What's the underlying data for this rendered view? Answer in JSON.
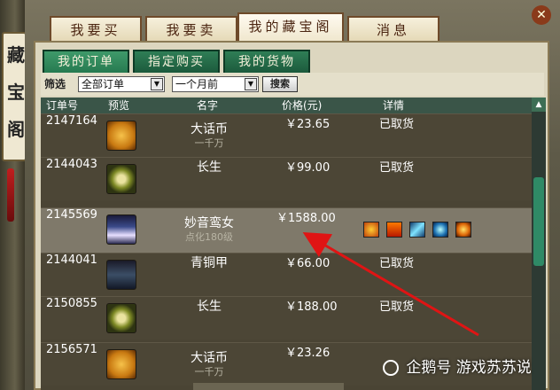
{
  "left_rail": {
    "chars": [
      "藏",
      "宝",
      "阁"
    ]
  },
  "main_tabs": [
    {
      "label": "我要买",
      "active": false
    },
    {
      "label": "我要卖",
      "active": false
    },
    {
      "label": "我的藏宝阁",
      "active": true
    },
    {
      "label": "消息",
      "active": false
    }
  ],
  "sub_tabs": [
    {
      "label": "我的订单",
      "active": true
    },
    {
      "label": "指定购买",
      "active": false
    },
    {
      "label": "我的货物",
      "active": false
    }
  ],
  "filter": {
    "label": "筛选",
    "order_type": "全部订单",
    "period": "一个月前",
    "search_label": "搜索"
  },
  "table": {
    "headers": [
      "订单号",
      "预览",
      "名字",
      "价格(元)",
      "详情"
    ],
    "rows": [
      {
        "order_id": "2147164",
        "thumb": "coin-icon",
        "name": "大话币",
        "sub": "一千万",
        "price": "￥23.65",
        "detail": "已取货"
      },
      {
        "order_id": "2144043",
        "thumb": "medal-icon",
        "name": "长生",
        "sub": "",
        "price": "￥99.00",
        "detail": "已取货"
      },
      {
        "order_id": "2145569",
        "thumb": "girl-portrait",
        "name": "妙音鸾女",
        "sub": "点化180级",
        "price": "￥1588.00",
        "detail": "",
        "highlighted": true
      },
      {
        "order_id": "2144041",
        "thumb": "armor-icon",
        "name": "青铜甲",
        "sub": "",
        "price": "￥66.00",
        "detail": "已取货"
      },
      {
        "order_id": "2150855",
        "thumb": "medal-icon",
        "name": "长生",
        "sub": "",
        "price": "￥188.00",
        "detail": "已取货"
      },
      {
        "order_id": "2156571",
        "thumb": "coin-icon",
        "name": "大话币",
        "sub": "一千万",
        "price": "￥23.26",
        "detail": ""
      }
    ]
  },
  "skills": [
    "fire-skill-icon",
    "flame-skill-icon",
    "ice-skill-icon",
    "water-skill-icon",
    "sun-skill-icon"
  ],
  "watermark": {
    "text": "企鹅号 游戏苏苏说"
  },
  "colors": {
    "accent_red": "#e01414",
    "highlight_row": "#7f796a",
    "header_green": "#3a5548"
  }
}
